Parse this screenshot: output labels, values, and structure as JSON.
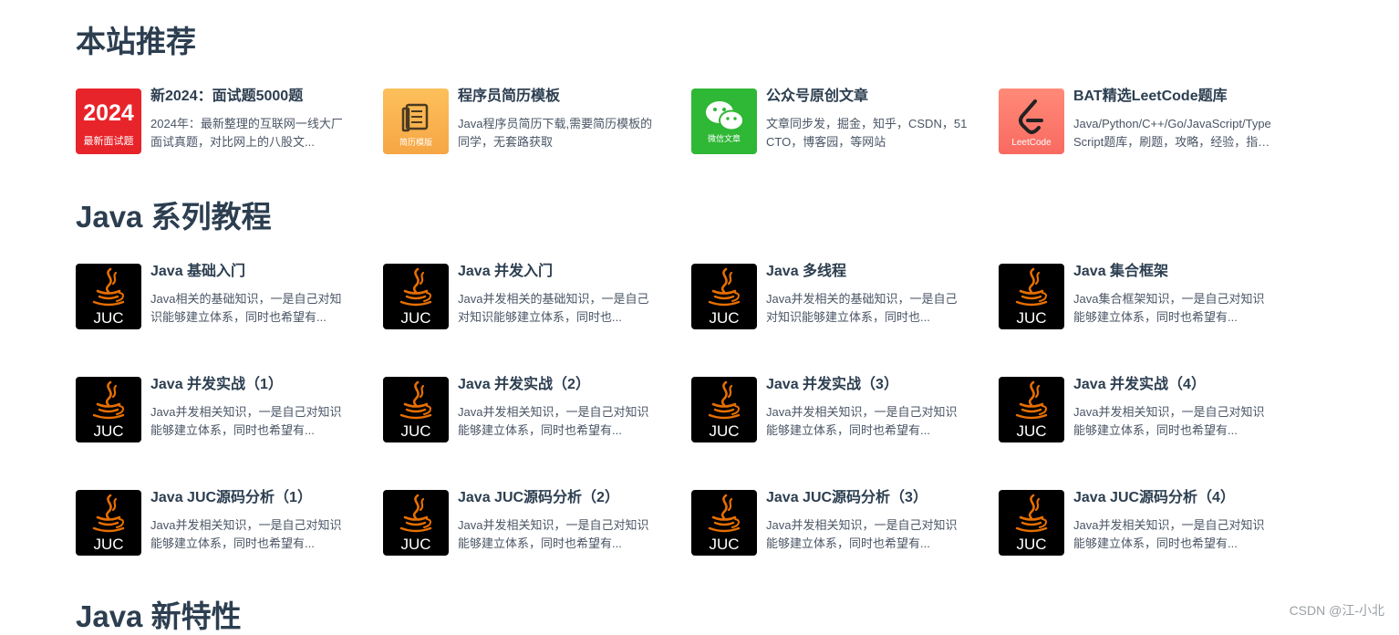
{
  "sections": {
    "recommend": "本站推荐",
    "java_series": "Java 系列教程",
    "java_new": "Java 新特性"
  },
  "recommend": [
    {
      "title": "新2024：面试题5000题",
      "desc": "2024年：最新整理的互联网一线大厂面试真题，对比网上的八股文...",
      "icon": "2024-badge-icon",
      "icon_text_big": "2024",
      "icon_text_small": "最新面试题"
    },
    {
      "title": "程序员简历模板",
      "desc": "Java程序员简历下载,需要简历模板的同学，无套路获取",
      "icon": "resume-template-icon",
      "icon_text_small": "简历模版"
    },
    {
      "title": "公众号原创文章",
      "desc": "文章同步发，掘金，知乎，CSDN，51CTO，博客园，等网站",
      "icon": "wechat-icon",
      "icon_text_small": "微信文章"
    },
    {
      "title": "BAT精选LeetCode题库",
      "desc": "Java/Python/C++/Go/JavaScript/TypeScript题库，刷题，攻略，经验，指南...",
      "icon": "leetcode-icon",
      "icon_text_small": "LeetCode"
    }
  ],
  "juc_label": "JUC",
  "series": [
    {
      "title": "Java 基础入门",
      "desc": "Java相关的基础知识，一是自己对知识能够建立体系，同时也希望有..."
    },
    {
      "title": "Java 并发入门",
      "desc": "Java并发相关的基础知识，一是自己对知识能够建立体系，同时也..."
    },
    {
      "title": "Java 多线程",
      "desc": "Java并发相关的基础知识，一是自己对知识能够建立体系，同时也..."
    },
    {
      "title": "Java 集合框架",
      "desc": "Java集合框架知识，一是自己对知识能够建立体系，同时也希望有..."
    },
    {
      "title": "Java 并发实战（1）",
      "desc": "Java并发相关知识，一是自己对知识能够建立体系，同时也希望有..."
    },
    {
      "title": "Java 并发实战（2）",
      "desc": "Java并发相关知识，一是自己对知识能够建立体系，同时也希望有..."
    },
    {
      "title": "Java 并发实战（3）",
      "desc": "Java并发相关知识，一是自己对知识能够建立体系，同时也希望有..."
    },
    {
      "title": "Java 并发实战（4）",
      "desc": "Java并发相关知识，一是自己对知识能够建立体系，同时也希望有..."
    },
    {
      "title": "Java JUC源码分析（1）",
      "desc": "Java并发相关知识，一是自己对知识能够建立体系，同时也希望有..."
    },
    {
      "title": "Java JUC源码分析（2）",
      "desc": "Java并发相关知识，一是自己对知识能够建立体系，同时也希望有..."
    },
    {
      "title": "Java JUC源码分析（3）",
      "desc": "Java并发相关知识，一是自己对知识能够建立体系，同时也希望有..."
    },
    {
      "title": "Java JUC源码分析（4）",
      "desc": "Java并发相关知识，一是自己对知识能够建立体系，同时也希望有..."
    }
  ],
  "watermark": "CSDN @江-小北"
}
